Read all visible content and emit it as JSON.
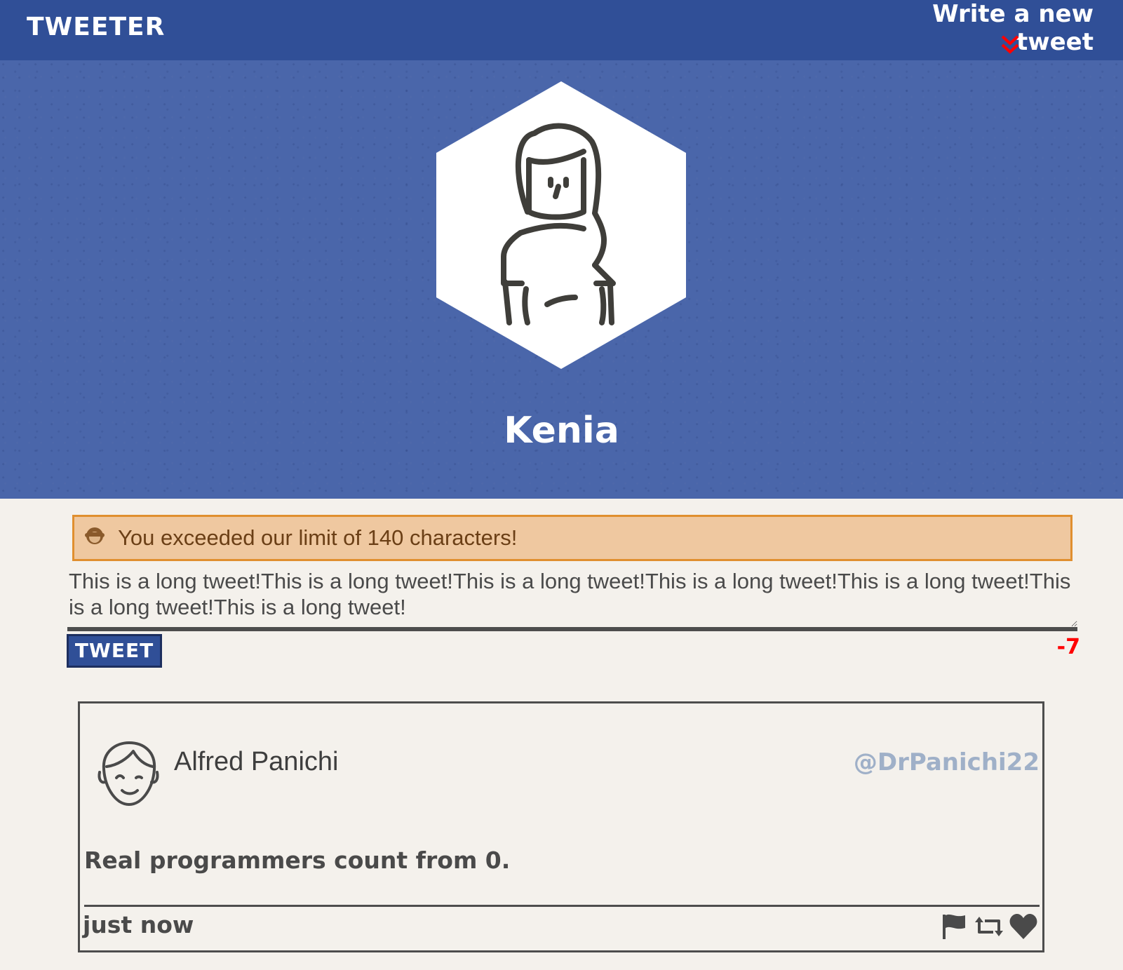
{
  "nav": {
    "brand": "TWEETER",
    "compose_label": "Write a new tweet",
    "arrow_icon": "double-chevron-down-icon",
    "arrow_color": "#ff0000"
  },
  "profile": {
    "name": "Kenia",
    "avatar_icon": "woman-avatar-icon"
  },
  "compose": {
    "error_message": "You exceeded our limit of 140 characters!",
    "error_icon": "see-no-evil-monkey-icon",
    "textarea_value": "This is a long tweet!This is a long tweet!This is a long tweet!This is a long tweet!This is a long tweet!This is a long tweet!This is a long tweet!",
    "submit_label": "TWEET",
    "counter": "-7",
    "counter_color": "#ff0000"
  },
  "tweets": [
    {
      "author": "Alfred Panichi",
      "handle": "@DrPanichi22",
      "body": "Real programmers count from 0.",
      "time": "just now",
      "avatar_icon": "man-avatar-icon",
      "actions": [
        "flag-icon",
        "retweet-icon",
        "heart-icon"
      ]
    }
  ],
  "colors": {
    "nav": "#304f97",
    "header": "#4a66aa",
    "error_bg": "#efc8a0",
    "error_border": "#e08f2f",
    "handle": "#9fb0c8"
  }
}
